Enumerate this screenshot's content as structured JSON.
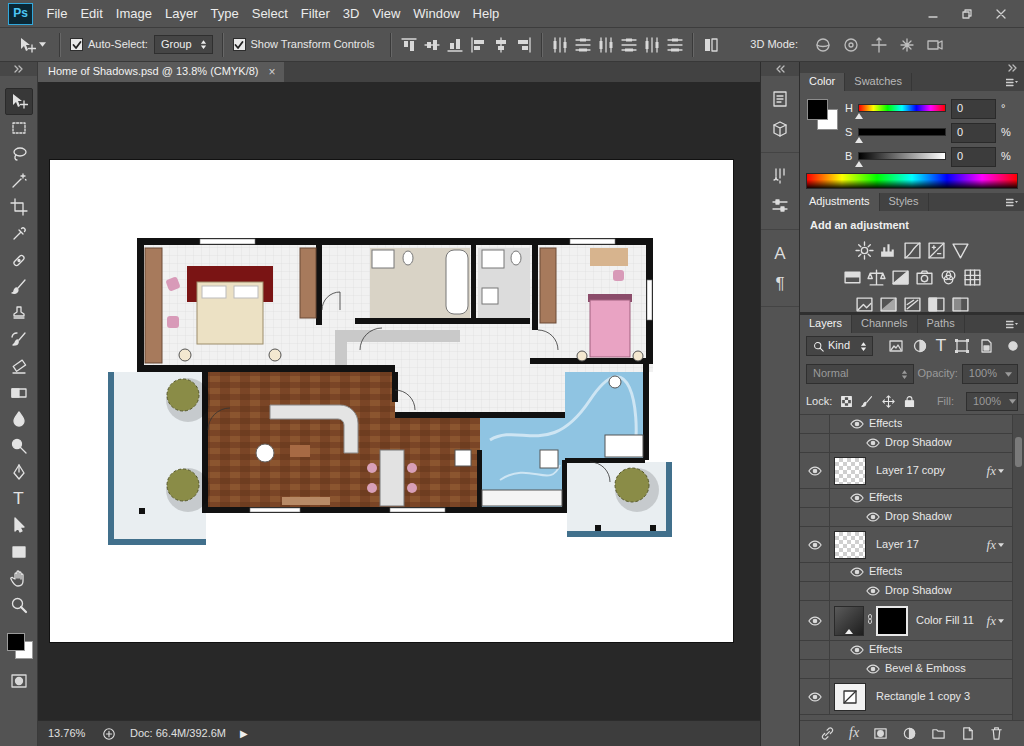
{
  "app": {
    "logo": "Ps"
  },
  "menu": [
    "File",
    "Edit",
    "Image",
    "Layer",
    "Type",
    "Select",
    "Filter",
    "3D",
    "View",
    "Window",
    "Help"
  ],
  "options_bar": {
    "auto_select": {
      "label": "Auto-Select:",
      "checked": true
    },
    "auto_select_target": "Group",
    "transform_controls": {
      "label": "Show Transform Controls",
      "checked": true
    },
    "mode_label": "3D Mode:"
  },
  "tools": [
    {
      "selected": true
    },
    {
      "selected": false
    },
    {
      "selected": false
    },
    {
      "selected": false
    },
    {
      "selected": false
    },
    {
      "selected": false
    },
    {
      "selected": false
    },
    {
      "selected": false
    },
    {
      "selected": false
    },
    {
      "selected": false
    },
    {
      "selected": false
    },
    {
      "selected": false
    },
    {
      "selected": false
    },
    {
      "selected": false
    },
    {
      "selected": false
    },
    {
      "selected": false,
      "glyph": "T"
    },
    {
      "selected": false
    },
    {
      "selected": false
    },
    {
      "selected": false
    },
    {
      "selected": false
    }
  ],
  "tool_colors": [
    {
      "color": "#000000"
    },
    {
      "color": "#ffffff"
    }
  ],
  "document": {
    "tab": "Home of Shadows.psd @ 13.8% (CMYK/8)",
    "close": "×",
    "selected": true
  },
  "status_bar": {
    "zoom": "13.76%",
    "doc": "Doc: 66.4M/392.6M",
    "arrow": "▶"
  },
  "side_strip": {
    "glyphs": [
      "A",
      "¶"
    ]
  },
  "color_panel": {
    "tabs": [
      {
        "label": "Color",
        "selected": true
      },
      {
        "label": "Swatches",
        "selected": false
      }
    ],
    "swatches": [
      {
        "color": "#000000"
      },
      {
        "color": "#ffffff"
      }
    ],
    "sliders": [
      {
        "name": "H",
        "value": "0",
        "unit": "°",
        "level": 0
      },
      {
        "name": "S",
        "value": "0",
        "unit": "%",
        "level": 0
      },
      {
        "name": "B",
        "value": "0",
        "unit": "%",
        "level": 0
      }
    ]
  },
  "adjustments_panel": {
    "tabs": [
      {
        "label": "Adjustments",
        "selected": true
      },
      {
        "label": "Styles",
        "selected": false
      }
    ],
    "heading": "Add an adjustment"
  },
  "layers_panel": {
    "tabs": [
      {
        "label": "Layers",
        "selected": true
      },
      {
        "label": "Channels",
        "selected": false
      },
      {
        "label": "Paths",
        "selected": false
      }
    ],
    "filter": {
      "value": "Kind",
      "type_glyph": "T"
    },
    "blend_mode": {
      "value": "Normal",
      "disabled": true
    },
    "opacity": {
      "label": "Opacity:",
      "value": "100%",
      "disabled": true
    },
    "lock_label": "Lock:",
    "fill": {
      "label": "Fill:",
      "value": "100%",
      "disabled": true
    },
    "layers": [
      {
        "kind": "effects",
        "label": "Effects",
        "visible": true
      },
      {
        "kind": "effect",
        "label": "Drop Shadow",
        "visible": true
      },
      {
        "kind": "layer",
        "label": "Layer 17 copy",
        "fx": "fx",
        "visible": true
      },
      {
        "kind": "effects",
        "label": "Effects",
        "visible": true
      },
      {
        "kind": "effect",
        "label": "Drop Shadow",
        "visible": true
      },
      {
        "kind": "layer",
        "label": "Layer 17",
        "fx": "fx",
        "visible": true
      },
      {
        "kind": "effects",
        "label": "Effects",
        "visible": true
      },
      {
        "kind": "effect",
        "label": "Drop Shadow",
        "visible": true
      },
      {
        "kind": "fill",
        "label": "Color Fill 11",
        "fx": "fx",
        "visible": true
      },
      {
        "kind": "effects",
        "label": "Effects",
        "visible": true
      },
      {
        "kind": "effect",
        "label": "Bevel & Emboss",
        "visible": true
      },
      {
        "kind": "shape",
        "label": "Rectangle 1 copy 3",
        "visible": true
      }
    ],
    "scrollbar": {
      "level": 0.08
    },
    "footer_fx": "fx"
  }
}
